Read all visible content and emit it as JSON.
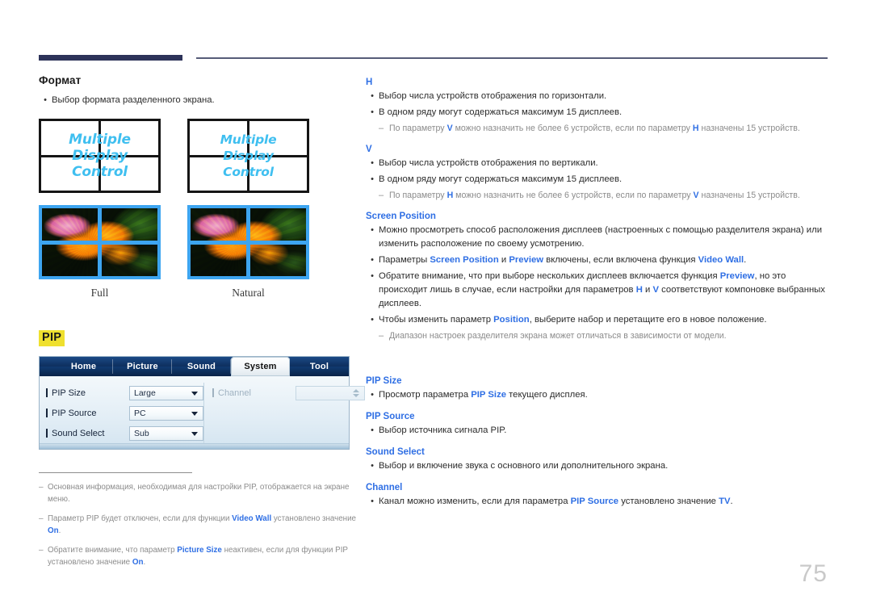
{
  "page": {
    "number": "75",
    "accent_blue": "#2f6fe4",
    "header_bar_color": "#2d3359",
    "highlight_yellow": "#efe02f"
  },
  "left": {
    "section_title": "Формат",
    "bullet": "Выбор формата разделенного экрана.",
    "figures": [
      {
        "wire_text_line1": "Multiple",
        "wire_text_line2": "Display",
        "wire_text_line3": "Control",
        "caption": "Full"
      },
      {
        "wire_text_line1": "Multiple",
        "wire_text_line2": "Display",
        "wire_text_line3": "Control",
        "caption": "Natural"
      }
    ],
    "pip_badge": "PIP",
    "osd": {
      "tabs": [
        {
          "label": "Home",
          "active": false
        },
        {
          "label": "Picture",
          "active": false
        },
        {
          "label": "Sound",
          "active": false
        },
        {
          "label": "System",
          "active": true
        },
        {
          "label": "Tool",
          "active": false
        }
      ],
      "rows": [
        {
          "label": "PIP Size",
          "value": "Large"
        },
        {
          "label": "PIP Source",
          "value": "PC"
        },
        {
          "label": "Sound Select",
          "value": "Sub"
        }
      ],
      "right_row": {
        "label": "Channel",
        "value": ""
      }
    },
    "footnotes": [
      {
        "p1": "Основная информация, необходимая для настройки PIP, отображается на экране меню.",
        "b1": "",
        "p2": "",
        "b2": "",
        "p3": ""
      },
      {
        "p1": "Параметр PIP будет отключен, если для функции ",
        "b1": "Video Wall",
        "p2": " установлено значение ",
        "b2": "On",
        "p3": "."
      },
      {
        "p1": "Обратите внимание, что параметр ",
        "b1": "Picture Size",
        "p2": " неактивен, если для функции PIP установлено значение ",
        "b2": "On",
        "p3": "."
      }
    ]
  },
  "right": {
    "h_section": {
      "heading": "H",
      "bullets": [
        "Выбор числа устройств отображения по горизонтали.",
        "В одном ряду могут содержаться максимум 15 дисплеев."
      ],
      "note": {
        "p1": "По параметру ",
        "b1": "V",
        "p2": " можно назначить не более 6 устройств, если по параметру ",
        "b2": "H",
        "p3": " назначены 15 устройств."
      }
    },
    "v_section": {
      "heading": "V",
      "bullets": [
        "Выбор числа устройств отображения по вертикали.",
        "В одном ряду могут содержаться максимум 15 дисплеев."
      ],
      "note": {
        "p1": "По параметру ",
        "b1": "H",
        "p2": " можно назначить не более 6 устройств, если по параметру ",
        "b2": "V",
        "p3": " назначены 15 устройств."
      }
    },
    "screen_position": {
      "heading": "Screen Position",
      "bullet1": "Можно просмотреть способ расположения дисплеев (настроенных с помощью разделителя экрана) или изменить расположение по своему усмотрению.",
      "bullet2": {
        "p1": "Параметры ",
        "b1": "Screen Position",
        "p2": " и ",
        "b2": "Preview",
        "p3": " включены, если включена функция ",
        "b3": "Video Wall",
        "p4": "."
      },
      "bullet3": {
        "p1": "Обратите внимание, что при выборе нескольких дисплеев включается функция ",
        "b1": "Preview",
        "p2": ", но это происходит лишь в случае, если настройки для параметров ",
        "b2": "H",
        "p3": " и ",
        "b3": "V",
        "p4": " соответствуют компоновке выбранных дисплеев."
      },
      "bullet4": {
        "p1": "Чтобы изменить параметр ",
        "b1": "Position",
        "p2": ", выберите набор и перетащите его в новое положение."
      },
      "note": "Диапазон настроек разделителя экрана может отличаться в зависимости от модели."
    },
    "pip_size": {
      "heading": "PIP Size",
      "bullet": {
        "p1": "Просмотр параметра ",
        "b1": "PIP Size",
        "p2": " текущего дисплея."
      }
    },
    "pip_source": {
      "heading": "PIP Source",
      "bullet": "Выбор источника сигнала PIP."
    },
    "sound_select": {
      "heading": "Sound Select",
      "bullet": "Выбор и включение звука с основного или дополнительного экрана."
    },
    "channel": {
      "heading": "Channel",
      "bullet": {
        "p1": "Канал можно изменить, если для параметра ",
        "b1": "PIP Source",
        "p2": " установлено значение ",
        "b2": "TV",
        "p3": "."
      }
    }
  }
}
